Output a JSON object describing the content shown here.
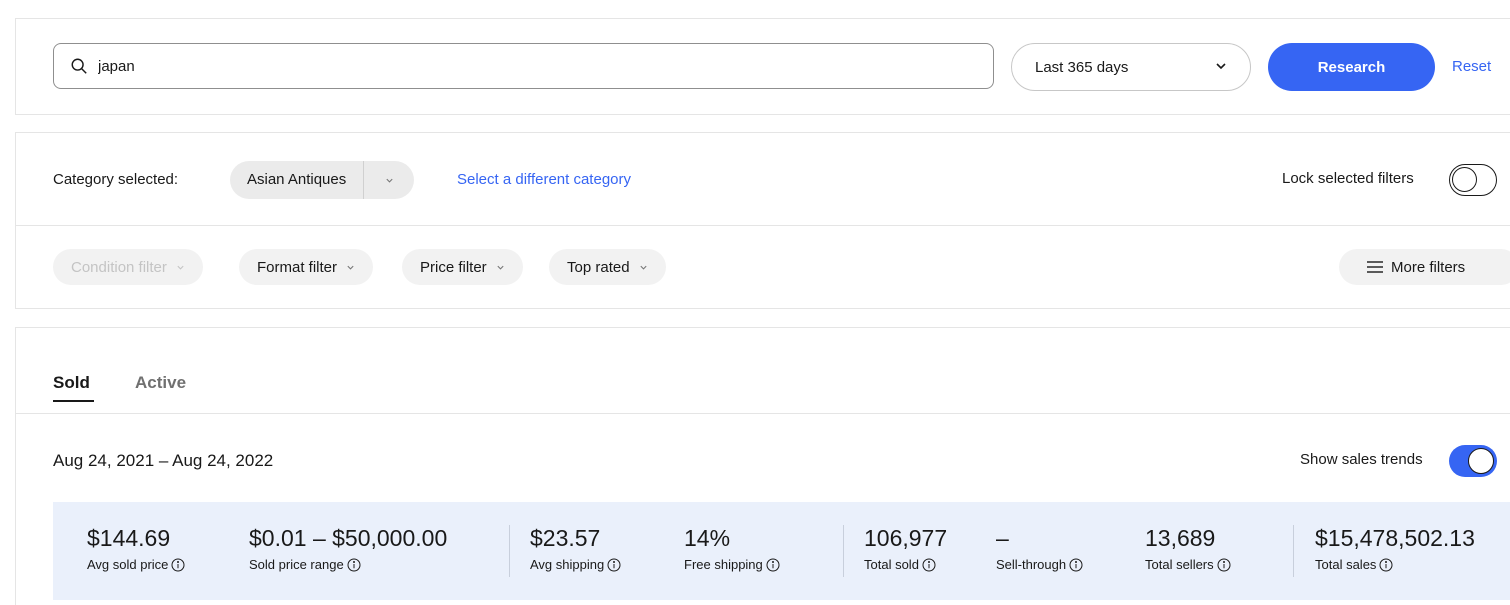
{
  "search": {
    "value": "japan",
    "placeholder": ""
  },
  "date_range_select": {
    "selected": "Last 365 days"
  },
  "buttons": {
    "research": "Research",
    "reset": "Reset"
  },
  "category": {
    "label": "Category selected:",
    "selected": "Asian Antiques",
    "change_link": "Select a different category"
  },
  "lock_filters": {
    "label": "Lock selected filters",
    "on": false
  },
  "filters": {
    "condition": "Condition filter",
    "format": "Format filter",
    "price": "Price filter",
    "top_rated": "Top rated",
    "more": "More filters"
  },
  "tabs": {
    "sold": "Sold",
    "active": "Active",
    "selected": "Sold"
  },
  "results": {
    "date_range": "Aug 24, 2021 – Aug 24, 2022",
    "sales_trends_label": "Show sales trends",
    "sales_trends_on": true
  },
  "stats": {
    "avg_sold_price": {
      "value": "$144.69",
      "label": "Avg sold price"
    },
    "sold_price_range": {
      "value": "$0.01 – $50,000.00",
      "label": "Sold price range"
    },
    "avg_shipping": {
      "value": "$23.57",
      "label": "Avg shipping"
    },
    "free_shipping": {
      "value": "14%",
      "label": "Free shipping"
    },
    "total_sold": {
      "value": "106,977",
      "label": "Total sold"
    },
    "sell_through": {
      "value": "–",
      "label": "Sell-through"
    },
    "total_sellers": {
      "value": "13,689",
      "label": "Total sellers"
    },
    "total_sales": {
      "value": "$15,478,502.13",
      "label": "Total sales"
    }
  },
  "colors": {
    "accent": "#3665f3",
    "stats_background": "#eaf0fb",
    "chip_background": "#f2f2f2",
    "text": "#191919"
  }
}
